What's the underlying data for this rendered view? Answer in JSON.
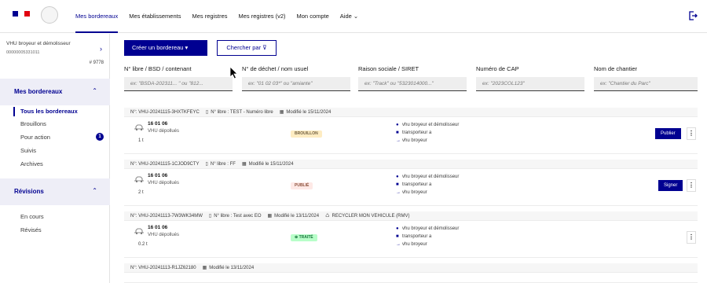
{
  "colors": {
    "primary": "#000091",
    "flag_blue": "#000091",
    "flag_white": "#ffffff",
    "flag_red": "#e1000f"
  },
  "header": {
    "nav": [
      "Mes bordereaux",
      "Mes établissements",
      "Mes registres",
      "Mes registres (v2)",
      "Mon compte",
      "Aide ⌄"
    ]
  },
  "sidebar": {
    "company_name": "VHU broyeur et démolisseur",
    "company_siret": "00000005331011",
    "company_id": "# 9778",
    "section1": "Mes bordereaux",
    "items1": [
      "Tous les bordereaux",
      "Brouillons",
      "Pour action",
      "Suivis",
      "Archives"
    ],
    "pour_action_badge": "1",
    "section2": "Révisions",
    "items2": [
      "En cours",
      "Révisés"
    ]
  },
  "toolbar": {
    "create_label": "Créer un bordereau ▾",
    "search_label": "Chercher par ⊽"
  },
  "filters": [
    {
      "label": "N° libre / BSD / contenant",
      "placeholder": "ex: \"BSDA-202311... \" ou \"812..."
    },
    {
      "label": "N° de déchet / nom usuel",
      "placeholder": "ex: \"01 02 03*\" ou \"amiante\""
    },
    {
      "label": "Raison sociale / SIRET",
      "placeholder": "ex: \"Track\" ou \"5323014000...\""
    },
    {
      "label": "Numéro de CAP",
      "placeholder": "ex: \"2023COL123\""
    },
    {
      "label": "Nom de chantier",
      "placeholder": "ex: \"Chantier du Parc\""
    }
  ],
  "cards": [
    {
      "id": "N°: VHU-20241115-3HXTKFEYC",
      "libre": "N° libre : TEST - Numéro libre",
      "modified": "Modifié le 15/11/2024",
      "extra": "",
      "code": "16 01 06",
      "desc": "VHU dépollués",
      "weight": "1 t",
      "status": "BROUILLON",
      "actors": [
        "vhu broyeur et démolisseur",
        "transporteur a",
        "vhu broyeur"
      ],
      "action": "Publier"
    },
    {
      "id": "N°: VHU-20241115-1CJOD9CTY",
      "libre": "N° libre : FF",
      "modified": "Modifié le 15/11/2024",
      "extra": "",
      "code": "16 01 06",
      "desc": "VHU dépollués",
      "weight": "2 t",
      "status": "PUBLIÉ",
      "actors": [
        "vhu broyeur et démolisseur",
        "transporteur a",
        "vhu broyeur"
      ],
      "action": "Signer"
    },
    {
      "id": "N°: VHU-20241113-7W3WK34MW",
      "libre": "N° libre : Test avec EO",
      "modified": "Modifié le 13/11/2024",
      "extra": "RECYCLER MON VEHICULE (RMV)",
      "code": "16 01 06",
      "desc": "VHU dépollués",
      "weight": "0.2 t",
      "status": "⊕ TRAITÉ",
      "actors": [
        "vhu broyeur et démolisseur",
        "transporteur a",
        "vhu broyeur"
      ],
      "action": ""
    },
    {
      "id": "N°: VHU-20241113-R1JZ62180",
      "libre": "",
      "modified": "Modifié le 13/11/2024",
      "extra": ""
    }
  ]
}
